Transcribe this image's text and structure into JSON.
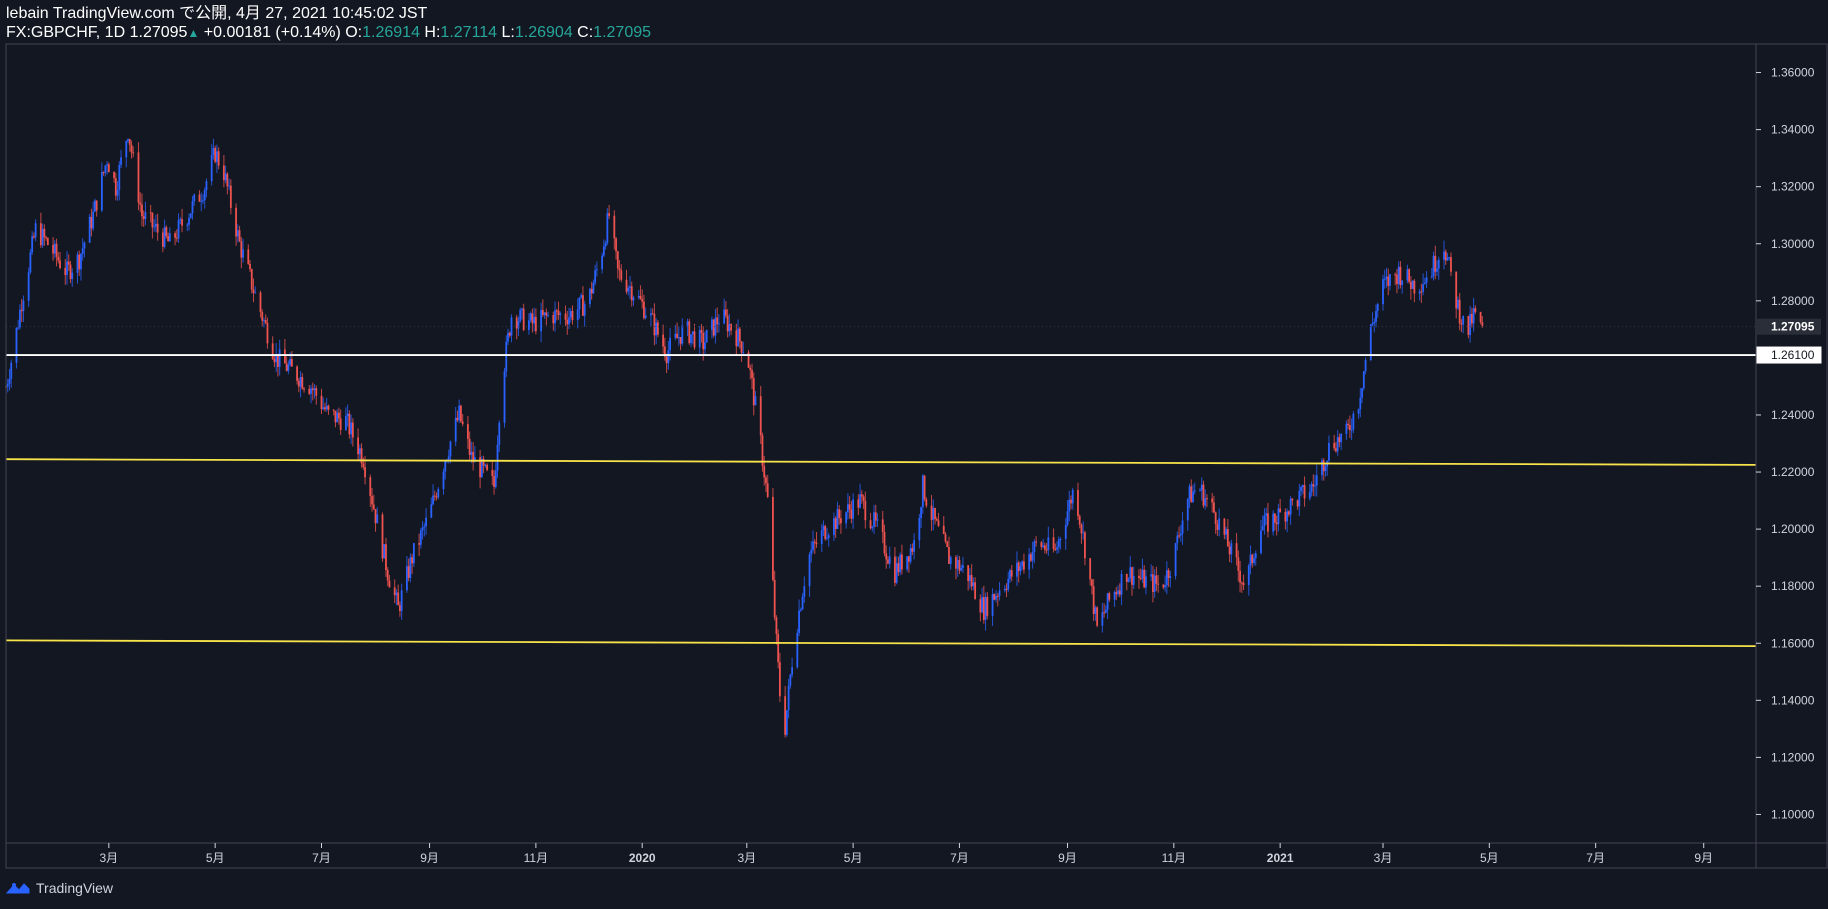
{
  "header": {
    "publish_line": "lebain TradingView.com で公開, 4月 27, 2021 10:45:02 JST",
    "symbol": "FX:GBPCHF, 1D",
    "last": "1.27095",
    "change_arrow": "▲",
    "change": "+0.00181 (+0.14%)",
    "o_label": "O:",
    "o": "1.26914",
    "h_label": "H:",
    "h": "1.27114",
    "l_label": "L:",
    "l": "1.26904",
    "c_label": "C:",
    "c": "1.27095"
  },
  "footer": {
    "brand": "TradingView",
    "icon": "tradingview-logo-icon"
  },
  "colors": {
    "background": "#131722",
    "up": "#2962ff",
    "down": "#ef5350",
    "support_line": "#f7e34a",
    "level_line": "#ffffff",
    "axis_text": "#d1d4dc",
    "grid_border": "#434651"
  },
  "chart_data": {
    "type": "candlestick",
    "symbol": "GBPCHF",
    "interval": "1D",
    "ylim": [
      1.09,
      1.37
    ],
    "y_ticks": [
      "1.36000",
      "1.34000",
      "1.32000",
      "1.30000",
      "1.28000",
      "1.24000",
      "1.22000",
      "1.20000",
      "1.18000",
      "1.16000",
      "1.14000",
      "1.12000",
      "1.10000"
    ],
    "price_labels": [
      {
        "value": 1.27095,
        "text": "1.27095",
        "style": "last"
      },
      {
        "value": 1.261,
        "text": "1.26100",
        "style": "level"
      }
    ],
    "x_start": "2019-01-01",
    "x_end": "2021-10-01",
    "x_ticks": [
      {
        "label": "3月",
        "date": "2019-03-01"
      },
      {
        "label": "5月",
        "date": "2019-05-01"
      },
      {
        "label": "7月",
        "date": "2019-07-01"
      },
      {
        "label": "9月",
        "date": "2019-09-01"
      },
      {
        "label": "11月",
        "date": "2019-11-01"
      },
      {
        "label": "2020",
        "date": "2020-01-01",
        "bold": true
      },
      {
        "label": "3月",
        "date": "2020-03-01"
      },
      {
        "label": "5月",
        "date": "2020-05-01"
      },
      {
        "label": "7月",
        "date": "2020-07-01"
      },
      {
        "label": "9月",
        "date": "2020-09-01"
      },
      {
        "label": "11月",
        "date": "2020-11-01"
      },
      {
        "label": "2021",
        "date": "2021-01-01",
        "bold": true
      },
      {
        "label": "3月",
        "date": "2021-03-01"
      },
      {
        "label": "5月",
        "date": "2021-05-01"
      },
      {
        "label": "7月",
        "date": "2021-07-01"
      },
      {
        "label": "9月",
        "date": "2021-09-01"
      }
    ],
    "close_path": [
      [
        "2019-01-01",
        1.25
      ],
      [
        "2019-01-05",
        1.262
      ],
      [
        "2019-01-10",
        1.28
      ],
      [
        "2019-01-18",
        1.305
      ],
      [
        "2019-01-25",
        1.3
      ],
      [
        "2019-02-05",
        1.29
      ],
      [
        "2019-02-12",
        1.295
      ],
      [
        "2019-02-20",
        1.31
      ],
      [
        "2019-02-28",
        1.33
      ],
      [
        "2019-03-05",
        1.32
      ],
      [
        "2019-03-12",
        1.34
      ],
      [
        "2019-03-20",
        1.31
      ],
      [
        "2019-03-28",
        1.305
      ],
      [
        "2019-04-05",
        1.3
      ],
      [
        "2019-04-15",
        1.31
      ],
      [
        "2019-04-25",
        1.32
      ],
      [
        "2019-05-01",
        1.332
      ],
      [
        "2019-05-06",
        1.325
      ],
      [
        "2019-05-15",
        1.3
      ],
      [
        "2019-05-25",
        1.28
      ],
      [
        "2019-06-05",
        1.26
      ],
      [
        "2019-06-15",
        1.255
      ],
      [
        "2019-06-25",
        1.25
      ],
      [
        "2019-07-05",
        1.24
      ],
      [
        "2019-07-15",
        1.238
      ],
      [
        "2019-07-25",
        1.225
      ],
      [
        "2019-08-01",
        1.205
      ],
      [
        "2019-08-08",
        1.185
      ],
      [
        "2019-08-14",
        1.172
      ],
      [
        "2019-08-22",
        1.19
      ],
      [
        "2019-09-01",
        1.205
      ],
      [
        "2019-09-10",
        1.225
      ],
      [
        "2019-09-18",
        1.24
      ],
      [
        "2019-09-25",
        1.225
      ],
      [
        "2019-10-02",
        1.22
      ],
      [
        "2019-10-08",
        1.215
      ],
      [
        "2019-10-12",
        1.25
      ],
      [
        "2019-10-18",
        1.275
      ],
      [
        "2019-10-30",
        1.272
      ],
      [
        "2019-11-10",
        1.275
      ],
      [
        "2019-11-20",
        1.275
      ],
      [
        "2019-12-01",
        1.28
      ],
      [
        "2019-12-08",
        1.295
      ],
      [
        "2019-12-13",
        1.31
      ],
      [
        "2019-12-18",
        1.29
      ],
      [
        "2019-12-25",
        1.285
      ],
      [
        "2020-01-05",
        1.275
      ],
      [
        "2020-01-15",
        1.262
      ],
      [
        "2020-01-25",
        1.27
      ],
      [
        "2020-02-05",
        1.265
      ],
      [
        "2020-02-15",
        1.275
      ],
      [
        "2020-02-22",
        1.27
      ],
      [
        "2020-03-01",
        1.262
      ],
      [
        "2020-03-08",
        1.235
      ],
      [
        "2020-03-13",
        1.21
      ],
      [
        "2020-03-18",
        1.16
      ],
      [
        "2020-03-22",
        1.125
      ],
      [
        "2020-03-28",
        1.16
      ],
      [
        "2020-04-05",
        1.19
      ],
      [
        "2020-04-15",
        1.2
      ],
      [
        "2020-04-25",
        1.205
      ],
      [
        "2020-05-05",
        1.21
      ],
      [
        "2020-05-15",
        1.2
      ],
      [
        "2020-05-25",
        1.185
      ],
      [
        "2020-06-05",
        1.195
      ],
      [
        "2020-06-10",
        1.215
      ],
      [
        "2020-06-15",
        1.205
      ],
      [
        "2020-06-25",
        1.19
      ],
      [
        "2020-07-05",
        1.185
      ],
      [
        "2020-07-15",
        1.172
      ],
      [
        "2020-07-25",
        1.18
      ],
      [
        "2020-08-05",
        1.187
      ],
      [
        "2020-08-15",
        1.195
      ],
      [
        "2020-08-25",
        1.192
      ],
      [
        "2020-09-05",
        1.215
      ],
      [
        "2020-09-12",
        1.19
      ],
      [
        "2020-09-18",
        1.165
      ],
      [
        "2020-09-25",
        1.175
      ],
      [
        "2020-10-05",
        1.185
      ],
      [
        "2020-10-15",
        1.182
      ],
      [
        "2020-10-25",
        1.18
      ],
      [
        "2020-11-01",
        1.19
      ],
      [
        "2020-11-08",
        1.21
      ],
      [
        "2020-11-15",
        1.215
      ],
      [
        "2020-11-25",
        1.205
      ],
      [
        "2020-12-05",
        1.19
      ],
      [
        "2020-12-12",
        1.18
      ],
      [
        "2020-12-20",
        1.2
      ],
      [
        "2021-01-01",
        1.205
      ],
      [
        "2021-01-10",
        1.21
      ],
      [
        "2021-01-20",
        1.215
      ],
      [
        "2021-01-30",
        1.23
      ],
      [
        "2021-02-08",
        1.233
      ],
      [
        "2021-02-15",
        1.245
      ],
      [
        "2021-02-22",
        1.27
      ],
      [
        "2021-03-01",
        1.285
      ],
      [
        "2021-03-10",
        1.29
      ],
      [
        "2021-03-20",
        1.285
      ],
      [
        "2021-03-28",
        1.29
      ],
      [
        "2021-04-05",
        1.3
      ],
      [
        "2021-04-12",
        1.28
      ],
      [
        "2021-04-18",
        1.268
      ],
      [
        "2021-04-22",
        1.275
      ],
      [
        "2021-04-27",
        1.2709
      ]
    ],
    "support_lines": [
      {
        "name": "support-upper",
        "color": "#f7e34a",
        "from": [
          "2019-01-01",
          1.2245
        ],
        "to": [
          "2021-10-01",
          1.2225
        ]
      },
      {
        "name": "support-lower",
        "color": "#f7e34a",
        "from": [
          "2019-01-01",
          1.161
        ],
        "to": [
          "2021-10-01",
          1.159
        ]
      }
    ],
    "level_line": {
      "name": "level-1.261",
      "color": "#ffffff",
      "value": 1.261,
      "from": "2019-01-01",
      "to": "2021-10-01"
    }
  }
}
